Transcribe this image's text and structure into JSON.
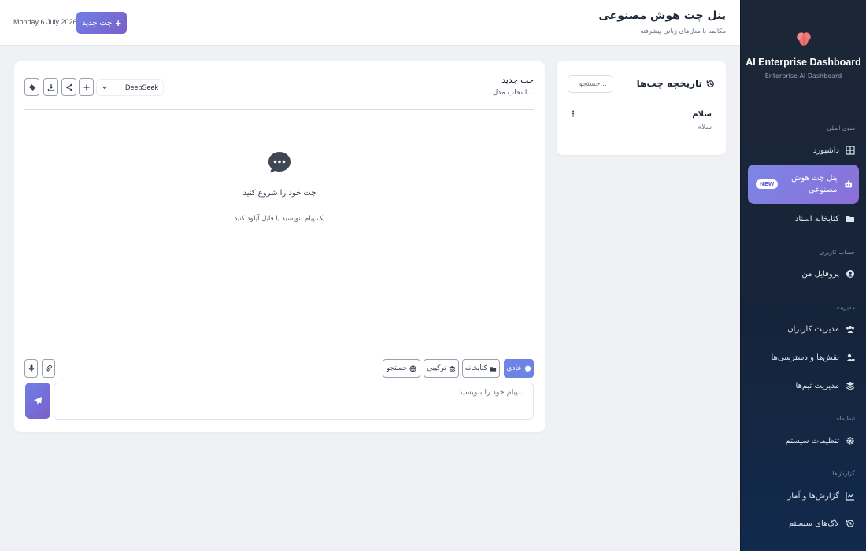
{
  "sidebar": {
    "brand_title": "AI Enterprise Dashboard",
    "brand_sub": "Enterprise AI Dashboard",
    "sections": {
      "main": "منوی اصلی",
      "account": "حساب کاربری",
      "admin": "مدیریت",
      "settings": "تنظیمات",
      "reports": "گزارش‌ها"
    },
    "items": {
      "dashboard": "داشبورد",
      "ai_chat": "پنل چت هوش مصنوعی",
      "library": "کتابخانه اسناد",
      "profile": "پروفایل من",
      "users": "مدیریت کاربران",
      "roles": "نقش‌ها و دسترسی‌ها",
      "teams": "مدیریت تیم‌ها",
      "system_settings": "تنظیمات سیستم",
      "reports": "گزارش‌ها و آمار",
      "logs": "لاگ‌های سیستم"
    },
    "badge_new": "NEW"
  },
  "header": {
    "title": "پنل چت هوش مصنوعی",
    "subtitle": "مکالمه با مدل‌های زبانی پیشرفته",
    "date": "Monday 6 July 2026",
    "new_chat_label": "چت جدید"
  },
  "history": {
    "title": "تاریخچه چت‌ها",
    "search_placeholder": "جستجو...",
    "items": [
      {
        "title": "سلام",
        "preview": "سلام"
      }
    ]
  },
  "chat": {
    "title": "چت جدید",
    "model_hint": "انتخاب مدل...",
    "model_selected": "DeepSeek",
    "empty_title": "چت خود را شروع کنید",
    "empty_sub": "یک پیام بنویسید یا فایل آپلود کنید",
    "modes": {
      "normal": "عادی",
      "library": "کتابخانه",
      "hybrid": "ترکیبی",
      "search": "جستجو"
    },
    "input_placeholder": "پیام خود را بنویسید..."
  },
  "colors": {
    "accent": "#6f7fe6",
    "accent2": "#7b5fc9",
    "sidebar_bg": "#1c2636"
  }
}
